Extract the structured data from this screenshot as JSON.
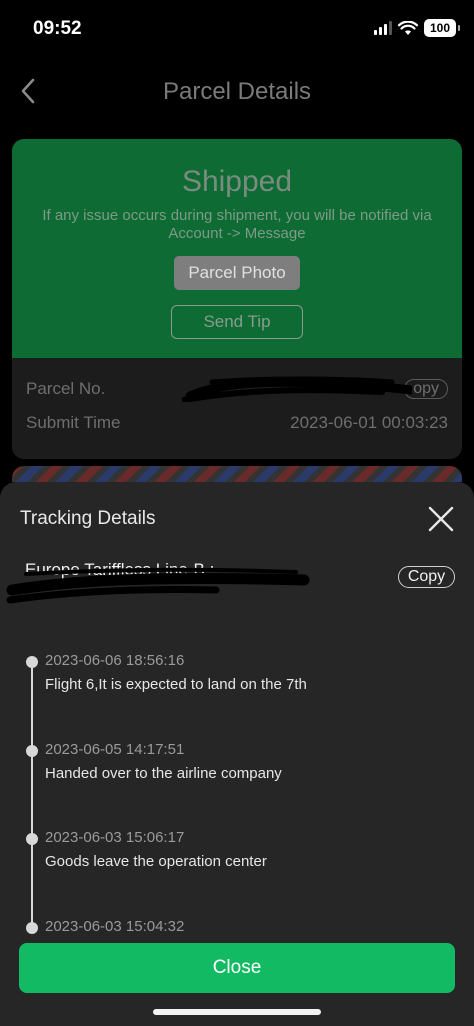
{
  "status_bar": {
    "time": "09:52",
    "battery": "100"
  },
  "nav": {
    "title": "Parcel Details"
  },
  "parcel_card": {
    "status": "Shipped",
    "note": "If any issue occurs during shipment, you will be notified via Account -> Message",
    "photo_button": "Parcel Photo",
    "tip_button": "Send Tip",
    "parcel_no_label": "Parcel No.",
    "parcel_copy": "opy",
    "submit_time_label": "Submit Time",
    "submit_time_value": "2023-06-01 00:03:23"
  },
  "sheet": {
    "title": "Tracking Details",
    "line_name": "Europe Tariffless Line-B :",
    "copy_label": "Copy",
    "events": [
      {
        "time": "2023-06-06 18:56:16",
        "desc": "Flight 6,It is expected to land on the 7th"
      },
      {
        "time": "2023-06-05 14:17:51",
        "desc": "Handed over to the airline company"
      },
      {
        "time": "2023-06-03 15:06:17",
        "desc": "Goods leave the operation center"
      },
      {
        "time": "2023-06-03 15:04:32",
        "desc": ""
      }
    ],
    "close_label": "Close"
  },
  "colors": {
    "accent_green": "#12bb63",
    "card_green": "#0d6b33"
  },
  "icons": [
    "back-chevron-icon",
    "close-x-icon",
    "signal-icon",
    "wifi-icon",
    "battery-icon"
  ]
}
